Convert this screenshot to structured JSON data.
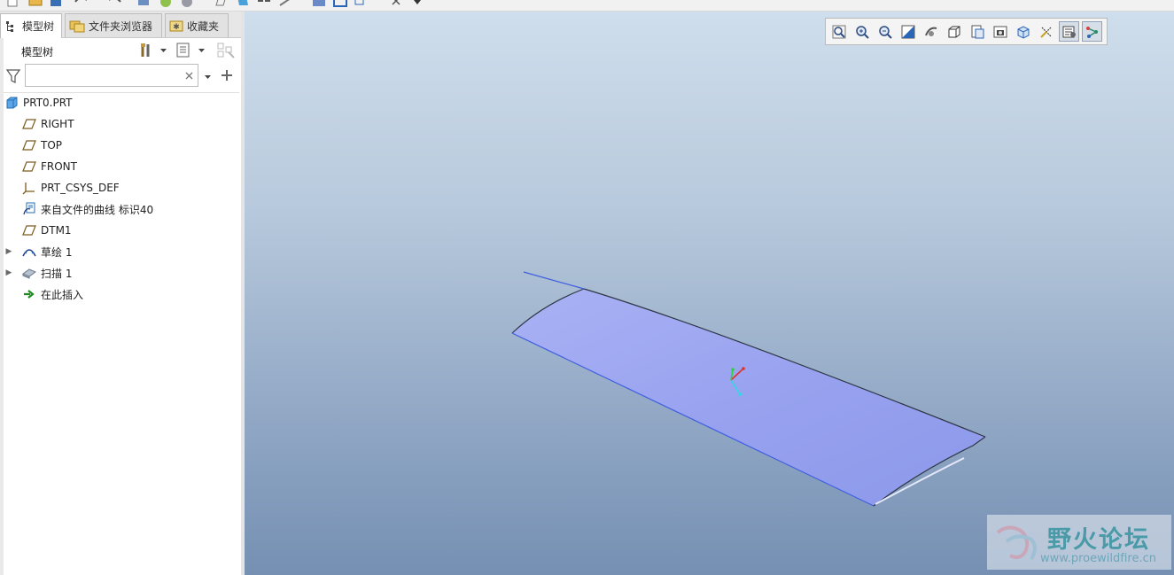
{
  "tabs": [
    {
      "label": "模型树",
      "icon": "model-tree-icon"
    },
    {
      "label": "文件夹浏览器",
      "icon": "folder-browser-icon"
    },
    {
      "label": "收藏夹",
      "icon": "favorites-icon"
    }
  ],
  "tree": {
    "title": "模型树",
    "filter_value": "",
    "items": [
      {
        "label": "PRT0.PRT",
        "icon": "part-icon"
      },
      {
        "label": "RIGHT",
        "icon": "datum-plane-icon"
      },
      {
        "label": "TOP",
        "icon": "datum-plane-icon"
      },
      {
        "label": "FRONT",
        "icon": "datum-plane-icon"
      },
      {
        "label": "PRT_CSYS_DEF",
        "icon": "coordinate-system-icon"
      },
      {
        "label": "来自文件的曲线 标识40",
        "icon": "curve-from-file-icon"
      },
      {
        "label": "DTM1",
        "icon": "datum-plane-icon"
      },
      {
        "label": "草绘 1",
        "icon": "sketch-icon"
      },
      {
        "label": "扫描 1",
        "icon": "sweep-icon"
      },
      {
        "label": "在此插入",
        "icon": "insert-here-arrow-icon"
      }
    ]
  },
  "graphics_toolbar": [
    "refit-icon",
    "zoom-in-icon",
    "zoom-out-icon",
    "repaint-icon",
    "spin-center-icon",
    "saved-orientations-icon",
    "saved-views-icon",
    "display-style-icon",
    "perspective-icon",
    "datum-display-icon",
    "annotation-display-icon",
    "appearance-icon"
  ],
  "watermark": {
    "title": "野火论坛",
    "url": "www.proewildfire.cn"
  },
  "colors": {
    "surface_fill": "#9aa6ee",
    "surface_edge": "#2f3646",
    "sketch_line": "#3f5fe0",
    "csys_x": "#e0302a",
    "csys_y": "#2fd040",
    "csys_z": "#30d8e8"
  }
}
